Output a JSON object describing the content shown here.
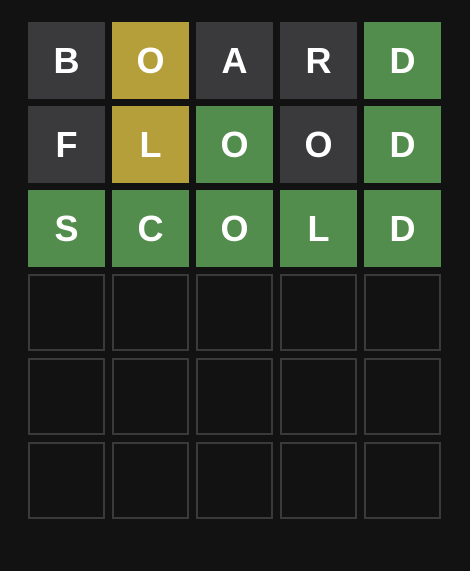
{
  "board": {
    "rows": [
      {
        "tiles": [
          {
            "letter": "B",
            "state": "absent"
          },
          {
            "letter": "O",
            "state": "present"
          },
          {
            "letter": "A",
            "state": "absent"
          },
          {
            "letter": "R",
            "state": "absent"
          },
          {
            "letter": "D",
            "state": "correct"
          }
        ]
      },
      {
        "tiles": [
          {
            "letter": "F",
            "state": "absent"
          },
          {
            "letter": "L",
            "state": "present"
          },
          {
            "letter": "O",
            "state": "correct"
          },
          {
            "letter": "O",
            "state": "absent"
          },
          {
            "letter": "D",
            "state": "correct"
          }
        ]
      },
      {
        "tiles": [
          {
            "letter": "S",
            "state": "correct"
          },
          {
            "letter": "C",
            "state": "correct"
          },
          {
            "letter": "O",
            "state": "correct"
          },
          {
            "letter": "L",
            "state": "correct"
          },
          {
            "letter": "D",
            "state": "correct"
          }
        ]
      },
      {
        "tiles": [
          {
            "letter": "",
            "state": "empty"
          },
          {
            "letter": "",
            "state": "empty"
          },
          {
            "letter": "",
            "state": "empty"
          },
          {
            "letter": "",
            "state": "empty"
          },
          {
            "letter": "",
            "state": "empty"
          }
        ]
      },
      {
        "tiles": [
          {
            "letter": "",
            "state": "empty"
          },
          {
            "letter": "",
            "state": "empty"
          },
          {
            "letter": "",
            "state": "empty"
          },
          {
            "letter": "",
            "state": "empty"
          },
          {
            "letter": "",
            "state": "empty"
          }
        ]
      },
      {
        "tiles": [
          {
            "letter": "",
            "state": "empty"
          },
          {
            "letter": "",
            "state": "empty"
          },
          {
            "letter": "",
            "state": "empty"
          },
          {
            "letter": "",
            "state": "empty"
          },
          {
            "letter": "",
            "state": "empty"
          }
        ]
      }
    ]
  },
  "colors": {
    "background": "#121213",
    "correct": "#538d4e",
    "present": "#b59f3b",
    "absent": "#3a3a3c",
    "empty_border": "#3a3a3c",
    "letter": "#ffffff"
  }
}
